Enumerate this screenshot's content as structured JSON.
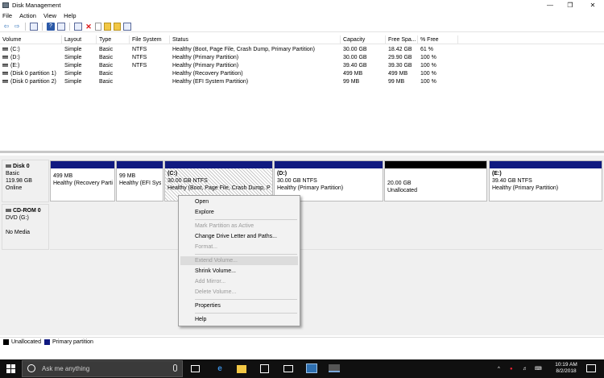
{
  "window": {
    "title": "Disk Management",
    "min": "—",
    "max": "❐",
    "close": "✕"
  },
  "menu": [
    "File",
    "Action",
    "View",
    "Help"
  ],
  "toolbar": {
    "back": "⇦",
    "forward": "⇨",
    "delete": "✕"
  },
  "volume_list": {
    "columns": [
      "Volume",
      "Layout",
      "Type",
      "File System",
      "Status",
      "Capacity",
      "Free Spa...",
      "% Free"
    ],
    "rows": [
      [
        "(C:)",
        "Simple",
        "Basic",
        "NTFS",
        "Healthy (Boot, Page File, Crash Dump, Primary Partition)",
        "30.00 GB",
        "18.42 GB",
        "61 %"
      ],
      [
        "(D:)",
        "Simple",
        "Basic",
        "NTFS",
        "Healthy (Primary Partition)",
        "30.00 GB",
        "29.90 GB",
        "100 %"
      ],
      [
        "(E:)",
        "Simple",
        "Basic",
        "NTFS",
        "Healthy (Primary Partition)",
        "39.40 GB",
        "39.30 GB",
        "100 %"
      ],
      [
        "(Disk 0 partition 1)",
        "Simple",
        "Basic",
        "",
        "Healthy (Recovery Partition)",
        "499 MB",
        "499 MB",
        "100 %"
      ],
      [
        "(Disk 0 partition 2)",
        "Simple",
        "Basic",
        "",
        "Healthy (EFI System Partition)",
        "99 MB",
        "99 MB",
        "100 %"
      ]
    ]
  },
  "disk0": {
    "name": "Disk 0",
    "type": "Basic",
    "size": "119.98 GB",
    "state": "Online",
    "partitions": [
      {
        "title": "",
        "size": "499 MB",
        "status": "Healthy (Recovery Partiti",
        "bar": "primary"
      },
      {
        "title": "",
        "size": "99 MB",
        "status": "Healthy (EFI Syst",
        "bar": "primary"
      },
      {
        "title": "(C:)",
        "size": "30.00 GB NTFS",
        "status": "Healthy (Boot, Page File, Crash Dump, Pr",
        "bar": "primary"
      },
      {
        "title": "(D:)",
        "size": "30.00 GB NTFS",
        "status": "Healthy (Primary Partition)",
        "bar": "primary"
      },
      {
        "title": "",
        "size": "20.00 GB",
        "status": "Unallocated",
        "bar": "unallocated"
      },
      {
        "title": "(E:)",
        "size": "39.40 GB NTFS",
        "status": "Healthy (Primary Partition)",
        "bar": "primary"
      }
    ]
  },
  "cdrom": {
    "name": "CD-ROM 0",
    "drive": "DVD (G:)",
    "media": "No Media"
  },
  "legend": [
    {
      "label": "Unallocated",
      "color": "#000000"
    },
    {
      "label": "Primary partition",
      "color": "#101a80"
    }
  ],
  "context_menu": {
    "items": [
      {
        "label": "Open",
        "enabled": true
      },
      {
        "label": "Explore",
        "enabled": true
      },
      {
        "label": "Mark Partition as Active",
        "enabled": false
      },
      {
        "label": "Change Drive Letter and Paths...",
        "enabled": true
      },
      {
        "label": "Format...",
        "enabled": false
      },
      {
        "label": "Extend Volume...",
        "enabled": false,
        "highlighted": true
      },
      {
        "label": "Shrink Volume...",
        "enabled": true
      },
      {
        "label": "Add Mirror...",
        "enabled": false
      },
      {
        "label": "Delete Volume...",
        "enabled": false
      },
      {
        "label": "Properties",
        "enabled": true
      },
      {
        "label": "Help",
        "enabled": true
      }
    ]
  },
  "taskbar": {
    "search_placeholder": "Ask me anything",
    "time": "10:19 AM",
    "date": "8/2/2018",
    "icons": [
      "task-view-icon",
      "edge-icon",
      "file-explorer-icon",
      "store-icon",
      "mail-icon",
      "remote-desktop-icon",
      "disk-management-icon"
    ]
  },
  "colors": {
    "primary_partition": "#101a80",
    "unallocated": "#000000",
    "taskbar": "#101010"
  }
}
